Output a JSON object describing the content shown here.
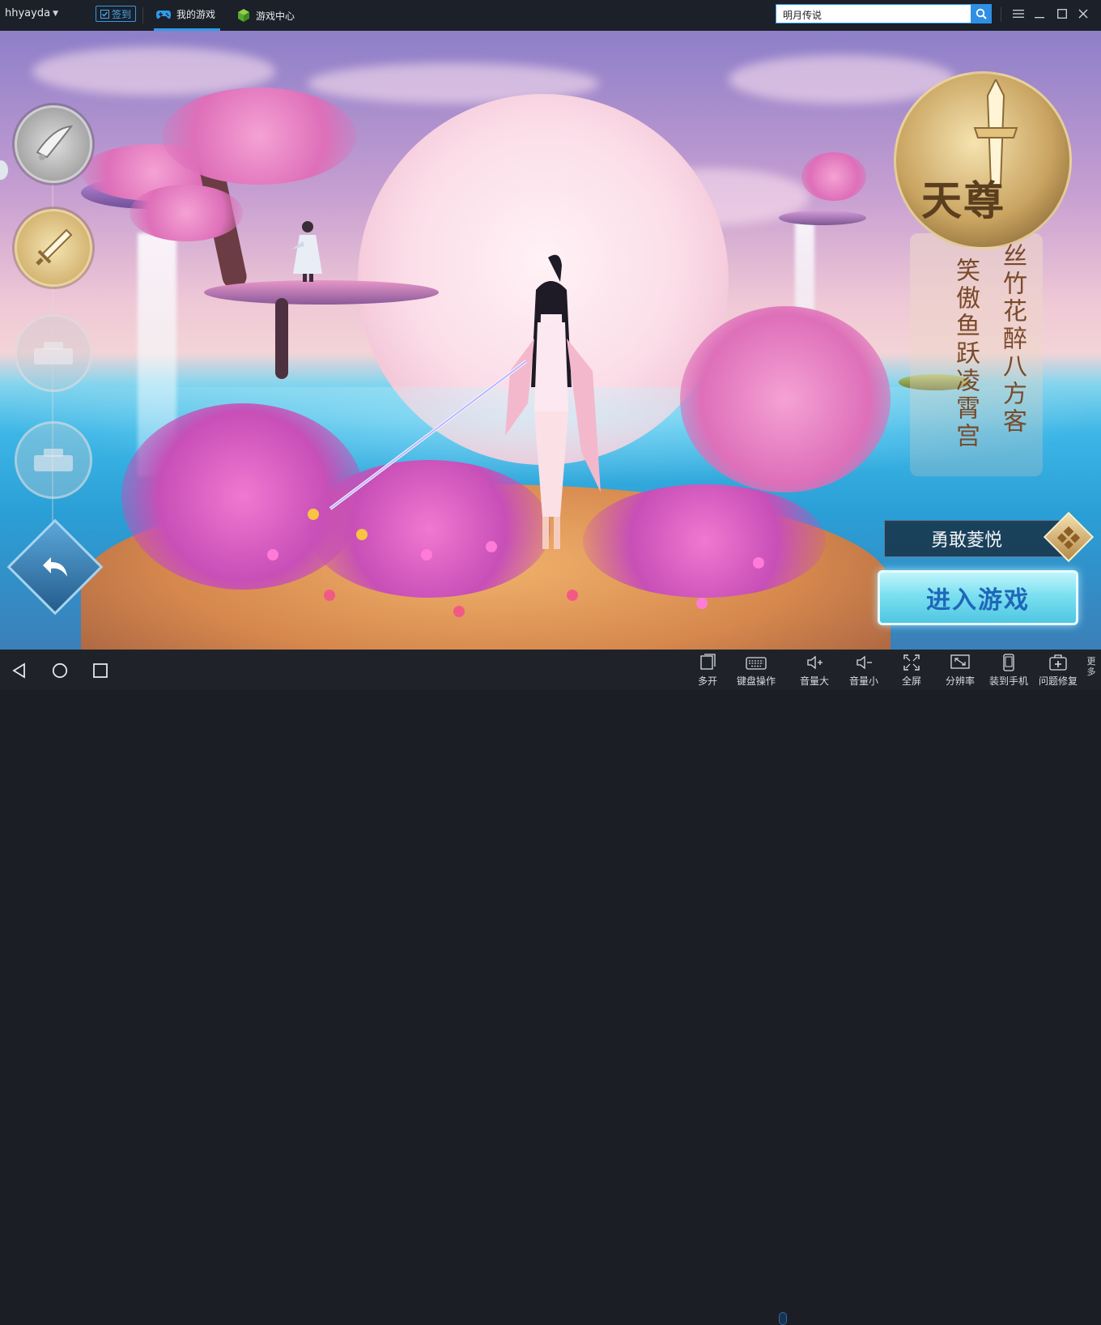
{
  "topbar": {
    "username": "hhyayda",
    "signin_label": "签到",
    "tabs": [
      {
        "label": "我的游戏",
        "icon": "gamepad-icon",
        "active": true
      },
      {
        "label": "游戏中心",
        "icon": "cube-icon",
        "active": false
      }
    ],
    "search": {
      "value": "明月传说"
    },
    "accent_color": "#2f9be9"
  },
  "game": {
    "emblem_title": "天尊",
    "banner_lines": [
      "丝竹花醉八方客",
      "笑傲鱼跃凌霄宫"
    ],
    "character_name": "勇敢菱悦",
    "enter_button": "进入游戏"
  },
  "bottombar": {
    "nav": [
      "back-triangle-icon",
      "home-circle-icon",
      "recent-square-icon"
    ],
    "tools": [
      {
        "label": "多开",
        "icon": "multi-window-icon"
      },
      {
        "label": "键盘操作",
        "icon": "keyboard-icon"
      },
      {
        "label": "音量大",
        "icon": "volume-up-icon"
      },
      {
        "label": "音量小",
        "icon": "volume-down-icon"
      },
      {
        "label": "全屏",
        "icon": "fullscreen-icon"
      },
      {
        "label": "分辨率",
        "icon": "resolution-icon"
      },
      {
        "label": "装到手机",
        "icon": "phone-install-icon"
      },
      {
        "label": "问题修复",
        "icon": "repair-kit-icon"
      }
    ],
    "more_label": "更多"
  }
}
